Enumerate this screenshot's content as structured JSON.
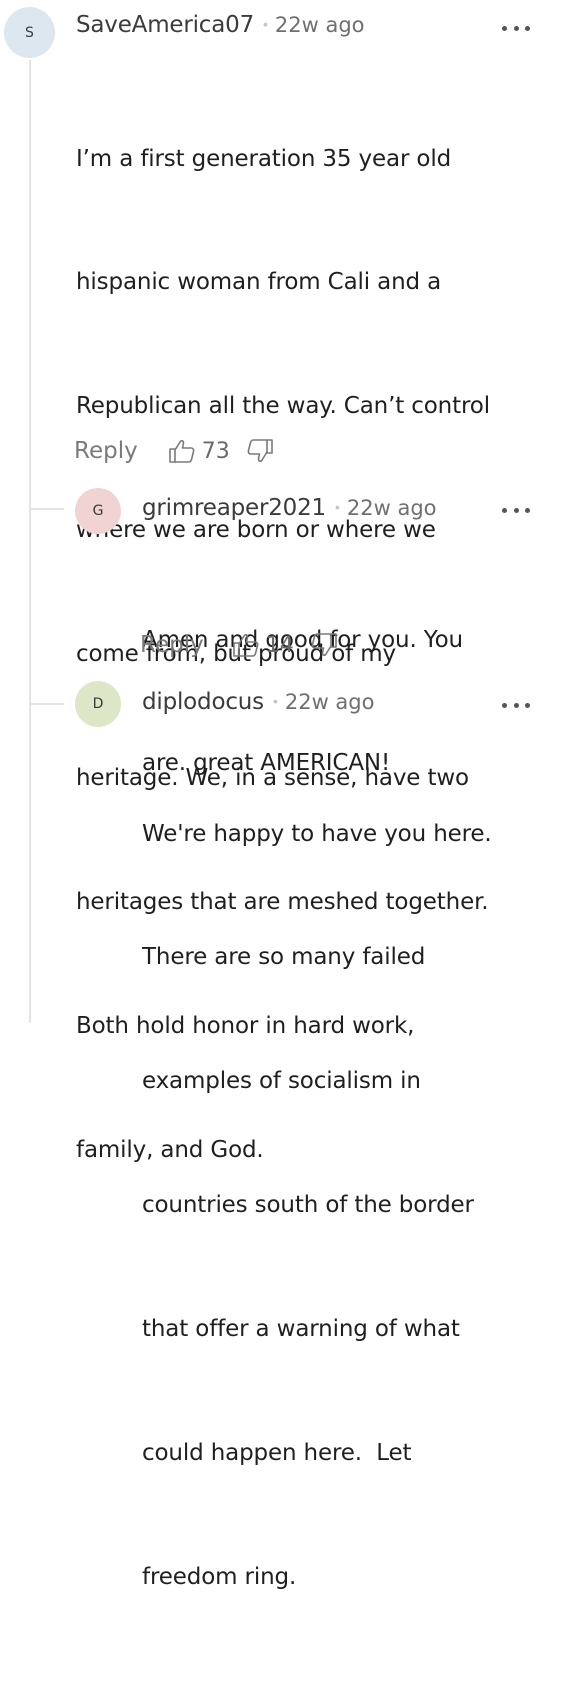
{
  "comments": [
    {
      "initial": "S",
      "username": "SaveAmerica07",
      "time": "22w ago",
      "avatar_color": "#dde7f0",
      "lines": [
        "I’m a first generation 35 year old",
        "hispanic woman from Cali and a",
        "Republican all the way. Can’t control",
        "where we are born or where we",
        "come from, but proud of my",
        "heritage. We, in a sense, have two",
        "heritages that are meshed together.",
        "Both hold honor in hard work,",
        "family, and God."
      ],
      "reply_label": "Reply",
      "likes": "73"
    },
    {
      "initial": "G",
      "username": "grimreaper2021",
      "time": "22w ago",
      "avatar_color": "#f1d3d3",
      "lines": [
        "Amen and good for you. You",
        "are. great AMERICAN!"
      ],
      "reply_label": "Reply",
      "likes": "14"
    },
    {
      "initial": "D",
      "username": "diplodocus",
      "time": "22w ago",
      "avatar_color": "#dde6c6",
      "lines": [
        "We're happy to have you here.",
        "There are so many failed",
        "examples of socialism in",
        "countries south of the border",
        "that offer a warning of what",
        "could happen here.  Let",
        "freedom ring."
      ]
    }
  ],
  "icons": {
    "upvote": "thumbs-up-icon",
    "downvote": "thumbs-down-icon",
    "more": "more-options-icon"
  }
}
